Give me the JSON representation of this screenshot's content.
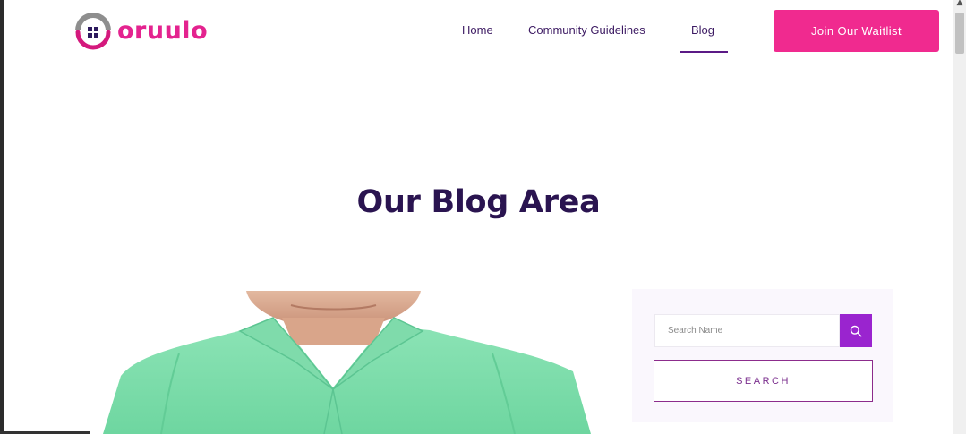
{
  "brand": {
    "name": "oruulo",
    "color": "#e4238f"
  },
  "nav": {
    "items": [
      {
        "label": "Home"
      },
      {
        "label": "Community Guidelines"
      },
      {
        "label": "Blog",
        "active": true
      }
    ],
    "text_color": "#3d1b63"
  },
  "cta": {
    "label": "Join Our Waitlist",
    "color": "#f02a8f"
  },
  "hero": {
    "title": "Our Blog Area",
    "color": "#2a1450"
  },
  "post": {
    "image_icon": "person-in-green-shirt-photo"
  },
  "sidebar": {
    "search_placeholder": "Search Name",
    "search_button": "SEARCH",
    "search_icon": "search-icon",
    "accent": "#9a24cf"
  }
}
